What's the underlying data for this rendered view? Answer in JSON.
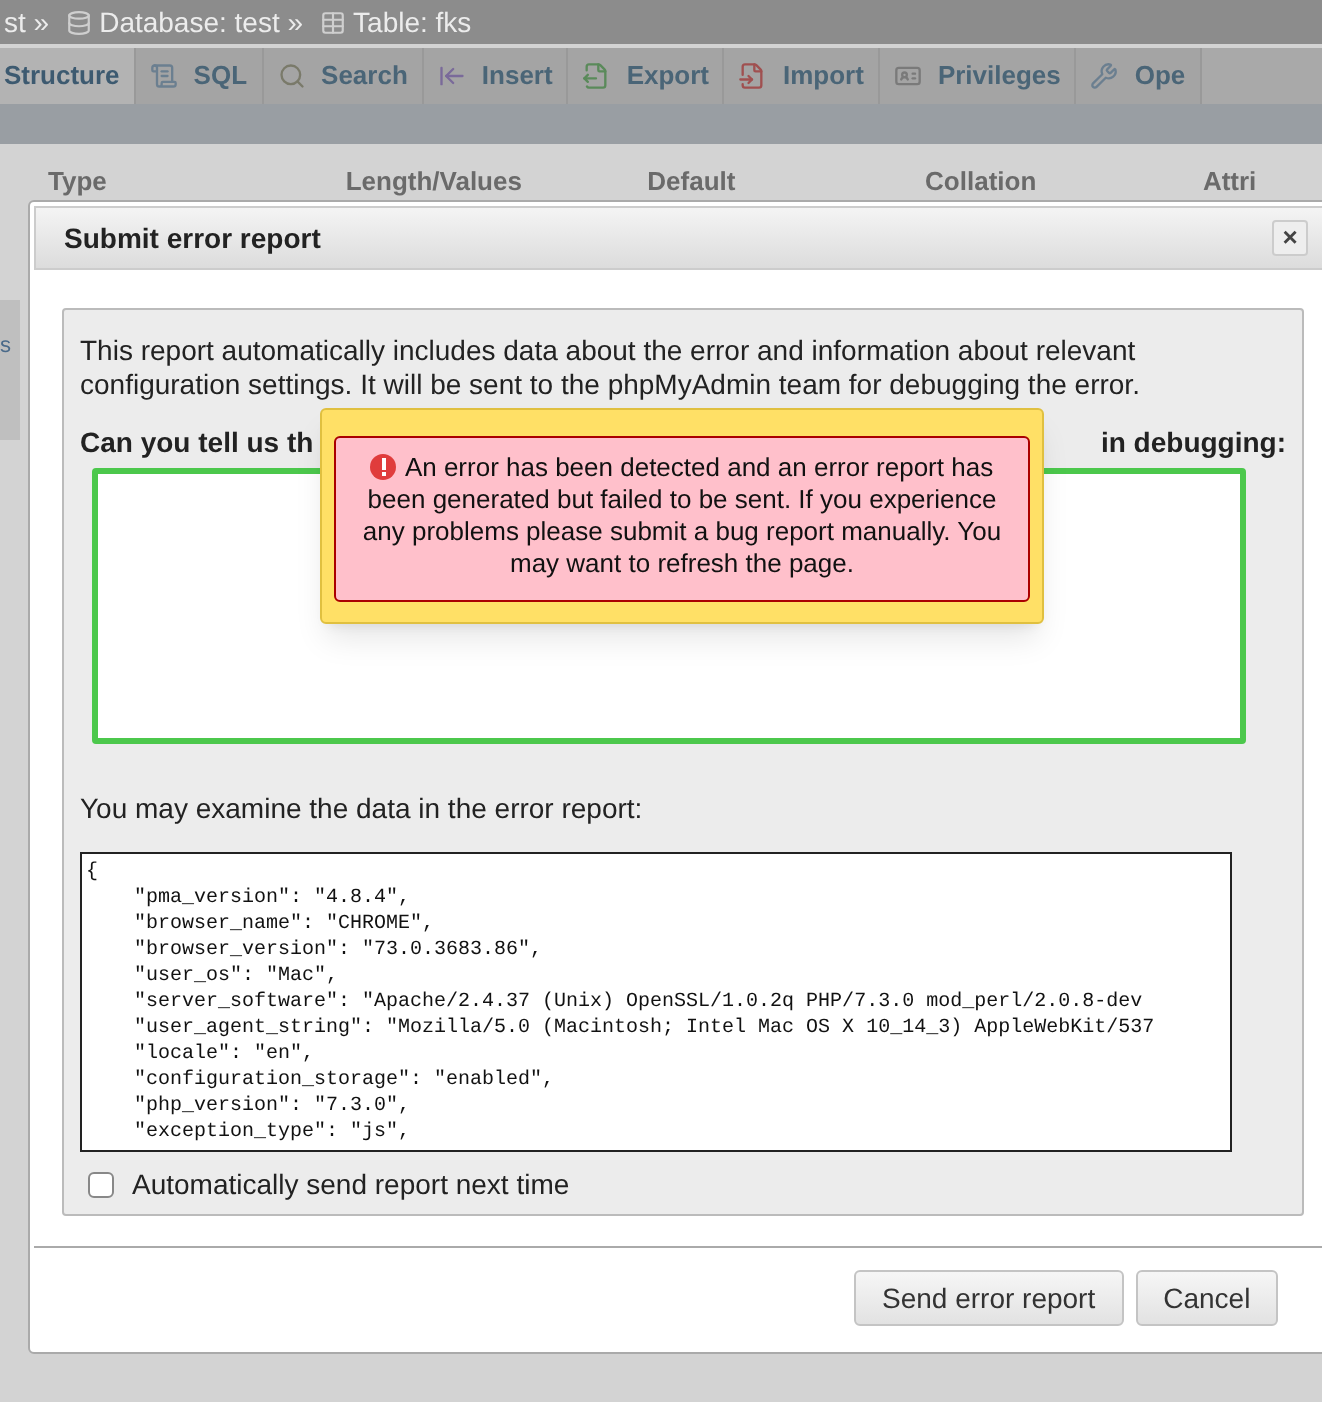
{
  "breadcrumb": [
    {
      "label": "st »"
    },
    {
      "label": "Database: test »"
    },
    {
      "label": "Table: fks"
    }
  ],
  "tabs": [
    {
      "label": "Structure",
      "selected": true
    },
    {
      "label": "SQL",
      "selected": false
    },
    {
      "label": "Search",
      "selected": false
    },
    {
      "label": "Insert",
      "selected": false
    },
    {
      "label": "Export",
      "selected": false
    },
    {
      "label": "Import",
      "selected": false
    },
    {
      "label": "Privileges",
      "selected": false
    },
    {
      "label": "Ope",
      "selected": false
    }
  ],
  "columns": [
    "Type",
    "Length/Values",
    "Default",
    "Collation",
    "Attri"
  ],
  "sidebar_fragment": "s",
  "dialog": {
    "title": "Submit error report",
    "close": "×",
    "intro": "This report automatically includes data about the error and information about relevant configuration settings. It will be sent to the phpMyAdmin team for debugging the error.",
    "question_left": "Can you tell us th",
    "question_right": "in debugging:",
    "examine": "You may examine the data in the error report:",
    "report_lines": [
      "{",
      "    \"pma_version\": \"4.8.4\",",
      "    \"browser_name\": \"CHROME\",",
      "    \"browser_version\": \"73.0.3683.86\",",
      "    \"user_os\": \"Mac\",",
      "    \"server_software\": \"Apache/2.4.37 (Unix) OpenSSL/1.0.2q PHP/7.3.0 mod_perl/2.0.8-dev",
      "    \"user_agent_string\": \"Mozilla/5.0 (Macintosh; Intel Mac OS X 10_14_3) AppleWebKit/537",
      "    \"locale\": \"en\",",
      "    \"configuration_storage\": \"enabled\",",
      "    \"php_version\": \"7.3.0\",",
      "    \"exception_type\": \"js\","
    ],
    "auto_send": {
      "label": "Automatically send report next time",
      "checked": false
    },
    "buttons": [
      "Send error report",
      "Cancel"
    ]
  },
  "alert": {
    "text": "An error has been detected and an error report has been generated but failed to be sent. If you experience any problems please submit a bug report manually. You may want to refresh the page."
  }
}
